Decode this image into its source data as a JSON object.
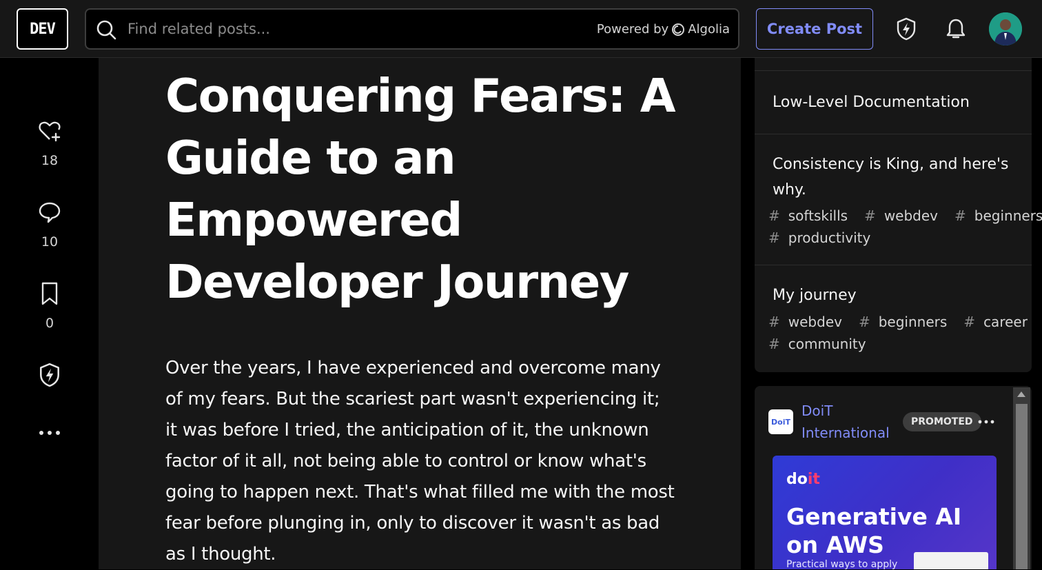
{
  "header": {
    "logo": "DEV",
    "search_placeholder": "Find related posts...",
    "powered_by": "Powered by",
    "powered_brand": "Algolia",
    "create_post": "Create Post"
  },
  "reactions": {
    "likes": "18",
    "comments": "10",
    "bookmarks": "0"
  },
  "article": {
    "title": "Conquering Fears: A Guide to an Empowered Developer Journey",
    "body": "Over the years, I have experienced and overcome many of my fears. But the scariest part wasn't experiencing it; it was before I tried, the anticipation of it, the unknown factor of it all, not being able to control or know what's going to happen next. That's what filled me with the most fear before plunging in, only to discover it wasn't as bad as I thought."
  },
  "related": [
    {
      "title": "Low-Level Documentation",
      "tags": []
    },
    {
      "title": "Consistency is King, and here's why.",
      "tags": [
        "softskills",
        "webdev",
        "beginners",
        "productivity"
      ]
    },
    {
      "title": "My journey",
      "tags": [
        "webdev",
        "beginners",
        "career",
        "community"
      ]
    }
  ],
  "promo": {
    "org_name": "DoiT International",
    "badge": "PROMOTED",
    "logo_text": "DoiT",
    "image_brand": "do",
    "image_brand_accent": "it",
    "image_headline": "Generative AI on AWS",
    "image_sub": "Practical ways to apply"
  },
  "colors": {
    "accent": "#818cf8",
    "background": "#000000",
    "card": "#171717"
  }
}
